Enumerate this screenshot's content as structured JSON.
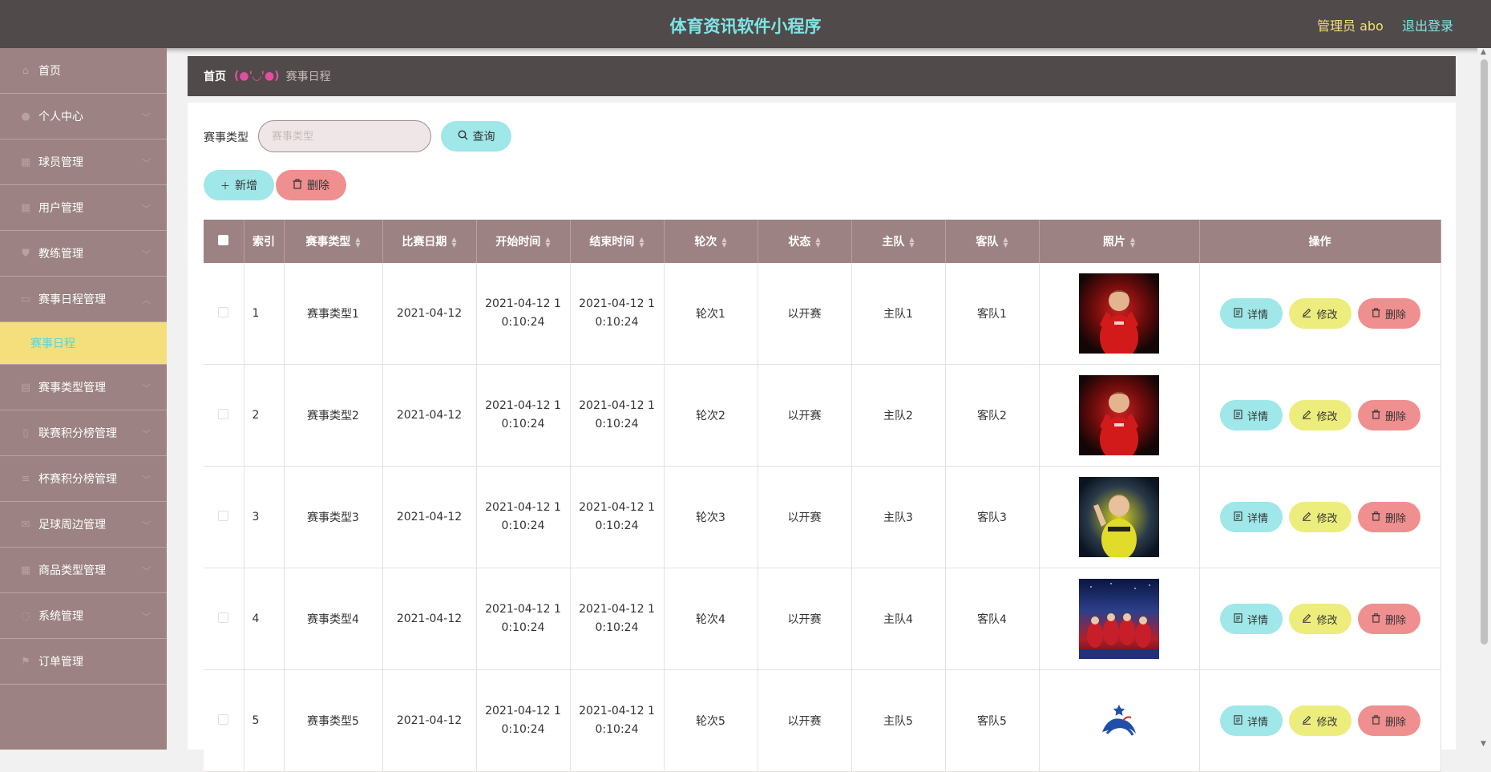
{
  "header": {
    "title": "体育资讯软件小程序",
    "user": "管理员 abo",
    "logout": "退出登录"
  },
  "sidebar": {
    "items": [
      {
        "label": "首页",
        "icon": "home-icon",
        "expandable": false
      },
      {
        "label": "个人中心",
        "icon": "user-icon",
        "expandable": true
      },
      {
        "label": "球员管理",
        "icon": "grid-icon",
        "expandable": true
      },
      {
        "label": "用户管理",
        "icon": "grid-icon",
        "expandable": true
      },
      {
        "label": "教练管理",
        "icon": "shield-icon",
        "expandable": true
      },
      {
        "label": "赛事日程管理",
        "icon": "chat-icon",
        "expandable": true,
        "expanded": true
      },
      {
        "label": "赛事类型管理",
        "icon": "list-icon",
        "expandable": true
      },
      {
        "label": "联赛积分榜管理",
        "icon": "doc-icon",
        "expandable": true
      },
      {
        "label": "杯赛积分榜管理",
        "icon": "menu-icon",
        "expandable": true
      },
      {
        "label": "足球周边管理",
        "icon": "mail-icon",
        "expandable": true
      },
      {
        "label": "商品类型管理",
        "icon": "grid-icon",
        "expandable": true
      },
      {
        "label": "系统管理",
        "icon": "circle-icon",
        "expandable": true
      },
      {
        "label": "订单管理",
        "icon": "flag-icon",
        "expandable": false
      }
    ],
    "submenu_active": "赛事日程"
  },
  "breadcrumb": {
    "home": "首页",
    "face": "(●'◡'●)",
    "current": "赛事日程"
  },
  "search": {
    "label": "赛事类型",
    "placeholder": "赛事类型",
    "query_button": "查询"
  },
  "actions": {
    "add": "新增",
    "delete": "删除"
  },
  "table": {
    "columns": [
      "索引",
      "赛事类型",
      "比赛日期",
      "开始时间",
      "结束时间",
      "轮次",
      "状态",
      "主队",
      "客队",
      "照片",
      "操作"
    ],
    "rows": [
      {
        "index": "1",
        "type": "赛事类型1",
        "date": "2021-04-12",
        "start_a": "2021-04-12 1",
        "start_b": "0:10:24",
        "end_a": "2021-04-12 1",
        "end_b": "0:10:24",
        "round": "轮次1",
        "status": "以开赛",
        "home": "主队1",
        "away": "客队1",
        "photo": "red"
      },
      {
        "index": "2",
        "type": "赛事类型2",
        "date": "2021-04-12",
        "start_a": "2021-04-12 1",
        "start_b": "0:10:24",
        "end_a": "2021-04-12 1",
        "end_b": "0:10:24",
        "round": "轮次2",
        "status": "以开赛",
        "home": "主队2",
        "away": "客队2",
        "photo": "red"
      },
      {
        "index": "3",
        "type": "赛事类型3",
        "date": "2021-04-12",
        "start_a": "2021-04-12 1",
        "start_b": "0:10:24",
        "end_a": "2021-04-12 1",
        "end_b": "0:10:24",
        "round": "轮次3",
        "status": "以开赛",
        "home": "主队3",
        "away": "客队3",
        "photo": "yellow"
      },
      {
        "index": "4",
        "type": "赛事类型4",
        "date": "2021-04-12",
        "start_a": "2021-04-12 1",
        "start_b": "0:10:24",
        "end_a": "2021-04-12 1",
        "end_b": "0:10:24",
        "round": "轮次4",
        "status": "以开赛",
        "home": "主队4",
        "away": "客队4",
        "photo": "team"
      },
      {
        "index": "5",
        "type": "赛事类型5",
        "date": "2021-04-12",
        "start_a": "2021-04-12 1",
        "start_b": "0:10:24",
        "end_a": "2021-04-12 1",
        "end_b": "0:10:24",
        "round": "轮次5",
        "status": "以开赛",
        "home": "主队5",
        "away": "客队5",
        "photo": "logo"
      }
    ],
    "row_actions": {
      "detail": "详情",
      "edit": "修改",
      "delete": "删除"
    }
  },
  "colors": {
    "header_bg": "#504a4a",
    "sidebar_bg": "#9c8282",
    "active_submenu_bg": "#f4df7c",
    "accent_cyan": "#9fe7e8",
    "accent_red": "#ef8f8f",
    "accent_yellow": "#eded7d"
  }
}
